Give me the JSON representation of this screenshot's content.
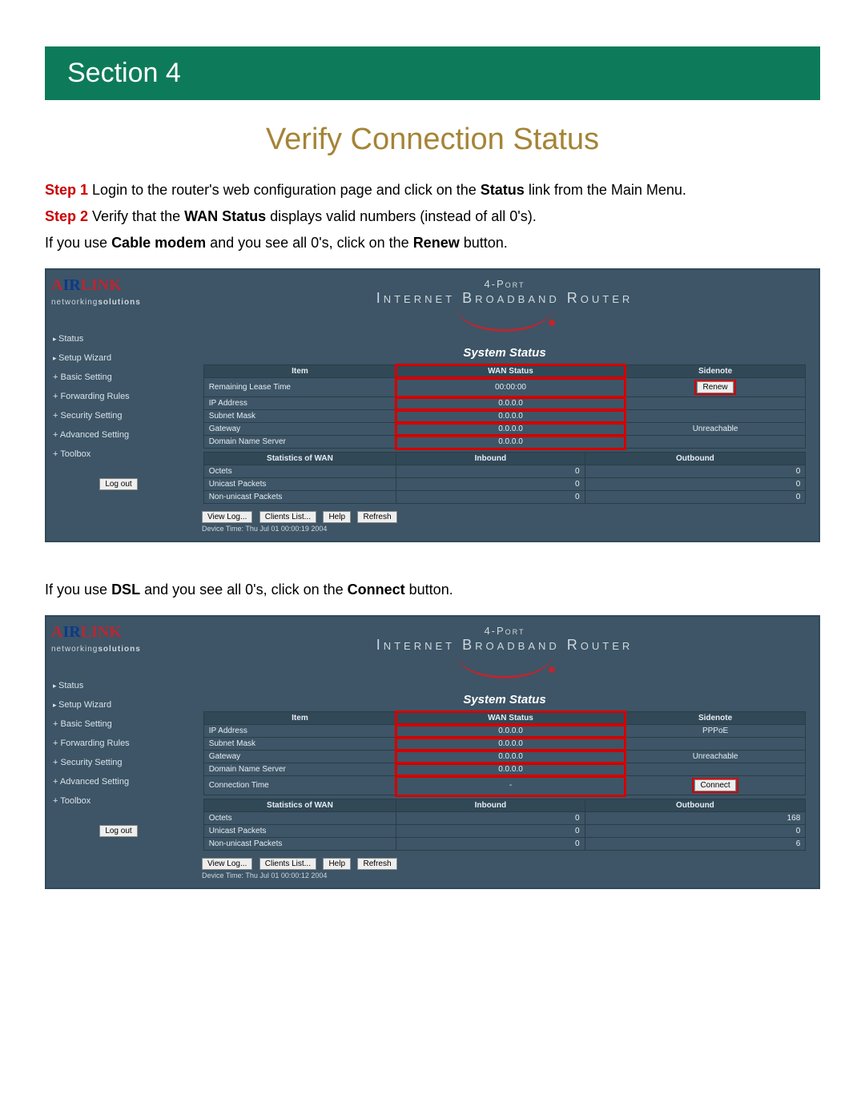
{
  "banner": "Section 4",
  "title": "Verify Connection Status",
  "step1": {
    "label": "Step 1",
    "before": " Login to the router's web configuration page and click on the ",
    "bold": "Status",
    "after": " link from the Main Menu."
  },
  "step2": {
    "label": "Step 2",
    "before": " Verify that the ",
    "bold": "WAN Status",
    "after": " displays valid numbers (instead of all 0's)."
  },
  "note1": {
    "before": "If you use ",
    "bold1": "Cable modem",
    "mid": " and you see all 0's, click on the ",
    "bold2": "Renew",
    "after": " button."
  },
  "note2": {
    "before": "If you use ",
    "bold1": "DSL",
    "mid": " and you see all 0's, click on the ",
    "bold2": "Connect",
    "after": " button."
  },
  "router": {
    "logo": {
      "air": "A",
      "ir": "IR",
      "link": "LINK",
      "tag_a": "networking",
      "tag_b": "solutions"
    },
    "header": {
      "line1": "4-Port",
      "line2": "Internet Broadband Router"
    },
    "sys_title": "System Status",
    "menu": [
      "Status",
      "Setup Wizard",
      "Basic Setting",
      "Forwarding Rules",
      "Security Setting",
      "Advanced Setting",
      "Toolbox"
    ],
    "logout": "Log out",
    "buttons": {
      "viewlog": "View Log...",
      "clients": "Clients List...",
      "help": "Help",
      "refresh": "Refresh"
    }
  },
  "shot1": {
    "headers": [
      "Item",
      "WAN Status",
      "Sidenote"
    ],
    "rows": [
      {
        "item": "Remaining Lease Time",
        "wan": "00:00:00",
        "side_btn": "Renew"
      },
      {
        "item": "IP Address",
        "wan": "0.0.0.0",
        "side": ""
      },
      {
        "item": "Subnet Mask",
        "wan": "0.0.0.0",
        "side": ""
      },
      {
        "item": "Gateway",
        "wan": "0.0.0.0",
        "side": "Unreachable"
      },
      {
        "item": "Domain Name Server",
        "wan": "0.0.0.0",
        "side": ""
      }
    ],
    "stats_headers": [
      "Statistics of WAN",
      "Inbound",
      "Outbound"
    ],
    "stats": [
      {
        "k": "Octets",
        "in": "0",
        "out": "0"
      },
      {
        "k": "Unicast Packets",
        "in": "0",
        "out": "0"
      },
      {
        "k": "Non-unicast Packets",
        "in": "0",
        "out": "0"
      }
    ],
    "device_time": "Device Time: Thu Jul 01 00:00:19 2004"
  },
  "shot2": {
    "headers": [
      "Item",
      "WAN Status",
      "Sidenote"
    ],
    "rows": [
      {
        "item": "IP Address",
        "wan": "0.0.0.0",
        "side": "PPPoE"
      },
      {
        "item": "Subnet Mask",
        "wan": "0.0.0.0",
        "side": ""
      },
      {
        "item": "Gateway",
        "wan": "0.0.0.0",
        "side": "Unreachable"
      },
      {
        "item": "Domain Name Server",
        "wan": "0.0.0.0",
        "side": ""
      },
      {
        "item": "Connection Time",
        "wan": "-",
        "side_btn": "Connect"
      }
    ],
    "stats_headers": [
      "Statistics of WAN",
      "Inbound",
      "Outbound"
    ],
    "stats": [
      {
        "k": "Octets",
        "in": "0",
        "out": "168"
      },
      {
        "k": "Unicast Packets",
        "in": "0",
        "out": "0"
      },
      {
        "k": "Non-unicast Packets",
        "in": "0",
        "out": "6"
      }
    ],
    "device_time": "Device Time: Thu Jul 01 00:00:12 2004"
  }
}
